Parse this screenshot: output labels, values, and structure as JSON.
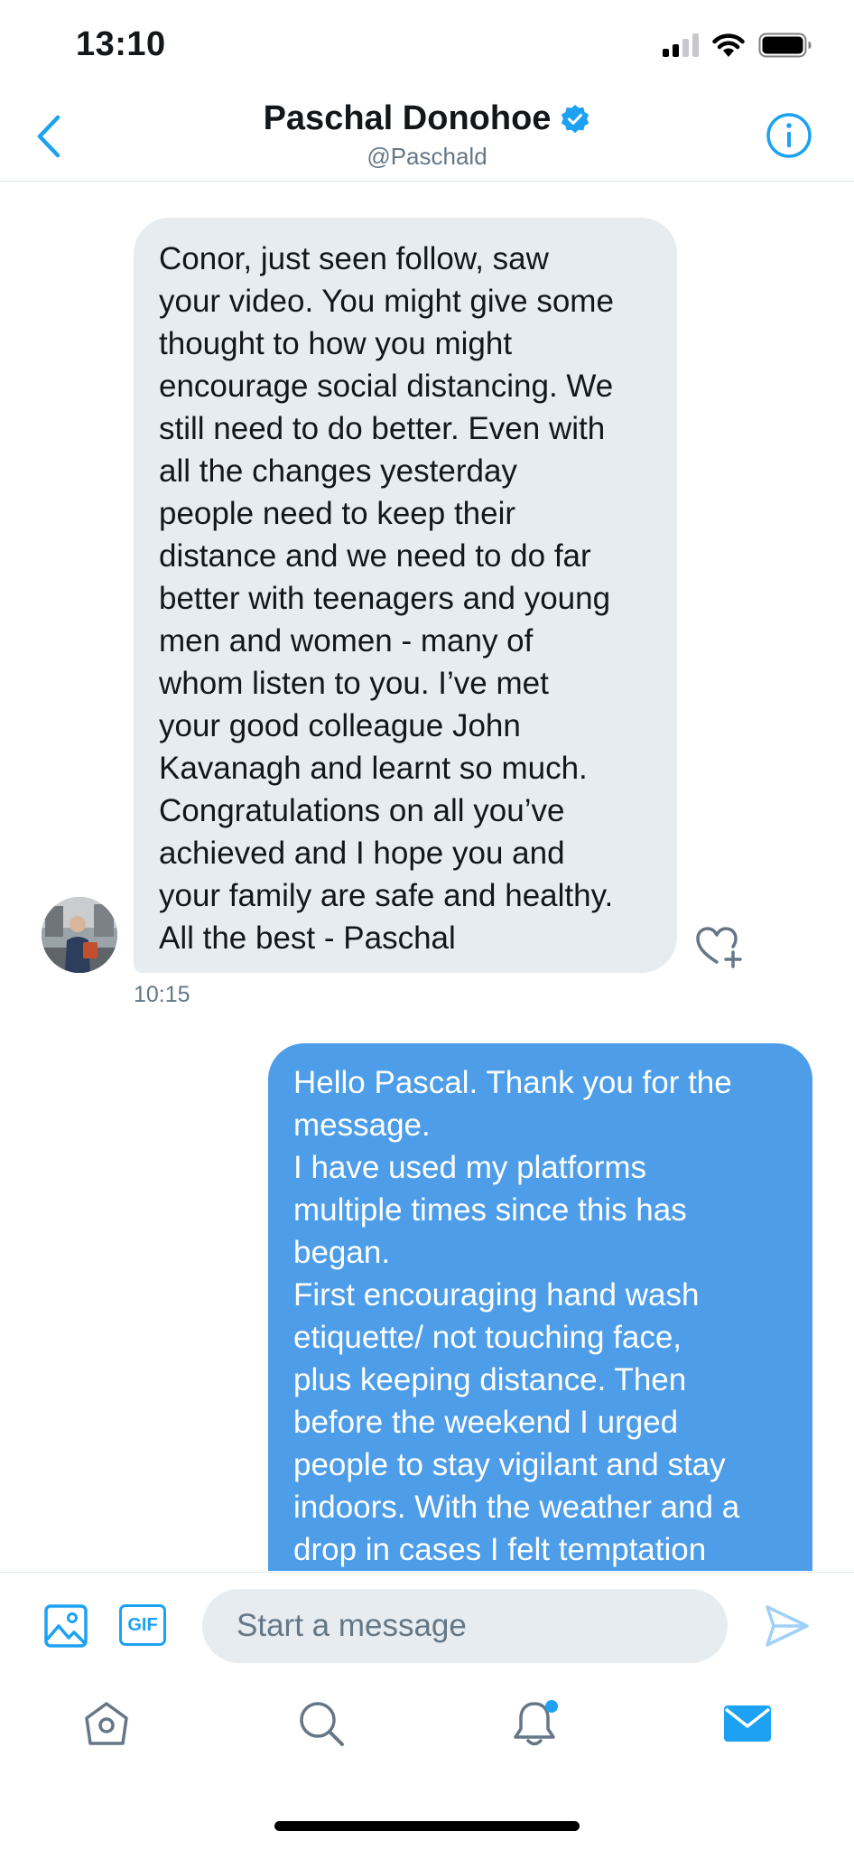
{
  "status_bar": {
    "time": "13:10"
  },
  "header": {
    "name": "Paschal Donohoe",
    "handle": "@Paschald",
    "verified": true
  },
  "conversation": {
    "received_message": {
      "text": "Conor, just seen follow, saw\nyour video. You might give some\nthought to how you might\nencourage social distancing. We\nstill need to do better. Even with\nall the changes yesterday\npeople need to keep their\ndistance and we need to do far\nbetter with teenagers and young\nmen and women - many of\nwhom listen to you. I’ve met\nyour good colleague John\nKavanagh and learnt so much.\nCongratulations on all you’ve\nachieved and I hope you and\nyour family are safe and healthy.\nAll the best - Paschal",
      "time": "10:15"
    },
    "sent_message": {
      "text": "Hello Pascal. Thank you for the\nmessage.\nI have used my platforms\nmultiple times since this has\nbegan.\nFirst encouraging hand wash\netiquette/ not touching face,\nplus keeping distance. Then\nbefore the weekend I urged\npeople to stay vigilant and stay\nindoors. With the weather and a\ndrop in cases I felt temptation"
    }
  },
  "composer": {
    "gif_label": "GIF",
    "placeholder": "Start a message"
  },
  "tab_bar": {
    "active_tab": "messages",
    "notifications_unread_dot": true
  },
  "colors": {
    "accent": "#1da1f2",
    "sent_bubble": "#4d9de9",
    "received_bubble": "#e6ecf0",
    "secondary_text": "#657786"
  },
  "icons": {
    "back": "chevron-left-icon",
    "info": "info-icon",
    "verified": "verified-badge-icon",
    "like": "heart-plus-icon",
    "image": "image-icon",
    "send": "send-icon",
    "home": "home-icon",
    "search": "search-icon",
    "notifications": "bell-icon",
    "messages": "mail-icon"
  }
}
